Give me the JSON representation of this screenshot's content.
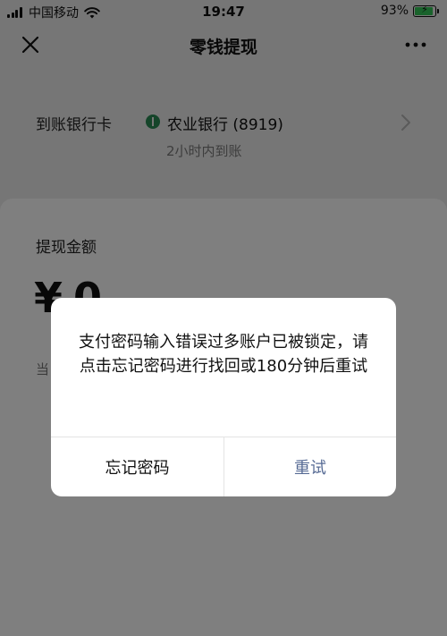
{
  "status_bar": {
    "carrier": "中国移动",
    "time": "19:47",
    "battery_percent": "93%",
    "battery_level": 0.93,
    "signal_icon": "signal-bars-icon",
    "wifi_icon": "wifi-icon",
    "battery_icon": "battery-charging-icon"
  },
  "nav": {
    "title": "零钱提现",
    "close_icon": "close-icon",
    "more_icon": "more-icon"
  },
  "bank": {
    "label": "到账银行卡",
    "name": "农业银行 (8919)",
    "arrival": "2小时内到账",
    "bank_icon": "bank-logo-icon",
    "chevron_icon": "chevron-right-icon"
  },
  "withdraw": {
    "amount_label": "提现金额",
    "currency": "¥",
    "amount": "0",
    "balance_text": "当"
  },
  "dialog": {
    "message": "支付密码输入错误过多账户已被锁定，请点击忘记密码进行找回或180分钟后重试",
    "forgot_password": "忘记密码",
    "retry": "重试"
  },
  "colors": {
    "background": "#ededed",
    "card": "#ffffff",
    "link_blue": "#576b95",
    "bank_green": "#2a8a55",
    "battery_green": "#35c759"
  }
}
